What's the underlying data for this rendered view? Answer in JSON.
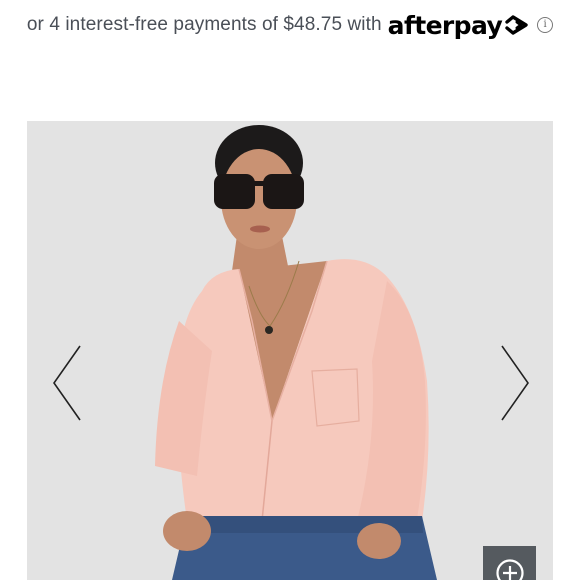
{
  "afterpay": {
    "text": "or 4 interest-free payments of $48.75 with",
    "brand": "afterpay",
    "info": "i"
  },
  "gallery": {
    "image": "woman-pink-shirt-sunglasses",
    "prev": "chevron-left-icon",
    "next": "chevron-right-icon",
    "zoom": "zoom-in-icon"
  },
  "colors": {
    "background": "#ffffff",
    "text": "#4a4f57",
    "brand": "#000000",
    "gallery_bg": "#e3e3e3",
    "shirt": "#f6c9bd",
    "jeans": "#3b5a8a",
    "zoom_bg": "#555a5f"
  }
}
